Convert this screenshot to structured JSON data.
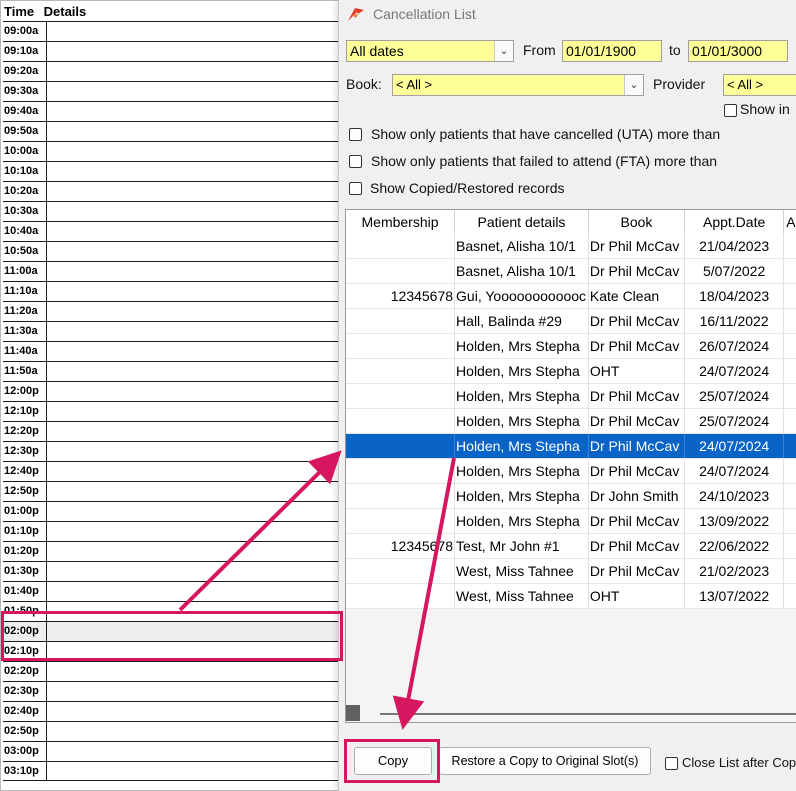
{
  "schedule": {
    "header": {
      "time": "Time",
      "details": "Details"
    },
    "times": [
      "09:00a",
      "09:10a",
      "09:20a",
      "09:30a",
      "09:40a",
      "09:50a",
      "10:00a",
      "10:10a",
      "10:20a",
      "10:30a",
      "10:40a",
      "10:50a",
      "11:00a",
      "11:10a",
      "11:20a",
      "11:30a",
      "11:40a",
      "11:50a",
      "12:00p",
      "12:10p",
      "12:20p",
      "12:30p",
      "12:40p",
      "12:50p",
      "01:00p",
      "01:10p",
      "01:20p",
      "01:30p",
      "01:40p",
      "01:50p",
      "02:00p",
      "02:10p",
      "02:20p",
      "02:30p",
      "02:40p",
      "02:50p",
      "03:00p",
      "03:10p"
    ]
  },
  "dialog": {
    "title": "Cancellation List",
    "date_filter": {
      "selected": "All dates",
      "from_label": "From",
      "from_value": "01/01/1900",
      "to_label": "to",
      "to_value": "01/01/3000"
    },
    "book": {
      "label": "Book:",
      "value": "< All >"
    },
    "provider": {
      "label": "Provider",
      "value": "< All >"
    },
    "show_in_label": "Show in",
    "options": [
      "Show only patients that have cancelled (UTA) more than",
      "Show only patients that failed to attend (FTA) more than",
      "Show Copied/Restored records"
    ],
    "table": {
      "headers": [
        "Membership",
        "Patient details",
        "Book",
        "Appt.Date",
        "A"
      ],
      "rows": [
        [
          "",
          "Basnet, Alisha 10/1",
          "Dr Phil McCav",
          "21/04/2023"
        ],
        [
          "",
          "Basnet, Alisha 10/1",
          "Dr Phil McCav",
          "5/07/2022"
        ],
        [
          "12345678",
          "Gui, Yoooooooooooc",
          "Kate Clean",
          "18/04/2023"
        ],
        [
          "",
          "Hall, Balinda #29",
          "Dr Phil McCav",
          "16/11/2022"
        ],
        [
          "",
          "Holden, Mrs Stepha",
          "Dr Phil McCav",
          "26/07/2024"
        ],
        [
          "",
          "Holden, Mrs Stepha",
          "OHT",
          "24/07/2024"
        ],
        [
          "",
          "Holden, Mrs Stepha",
          "Dr Phil McCav",
          "25/07/2024"
        ],
        [
          "",
          "Holden, Mrs Stepha",
          "Dr Phil McCav",
          "25/07/2024"
        ],
        [
          "",
          "Holden, Mrs Stepha",
          "Dr Phil McCav",
          "24/07/2024"
        ],
        [
          "",
          "Holden, Mrs Stepha",
          "Dr Phil McCav",
          "24/07/2024"
        ],
        [
          "",
          "Holden, Mrs Stepha",
          "Dr John Smith",
          "24/10/2023"
        ],
        [
          "",
          "Holden, Mrs Stepha",
          "Dr Phil McCav",
          "13/09/2022"
        ],
        [
          "12345678",
          "Test, Mr John #1",
          "Dr Phil McCav",
          "22/06/2022"
        ],
        [
          "",
          "West, Miss Tahnee",
          "Dr Phil McCav",
          "21/02/2023"
        ],
        [
          "",
          "West, Miss Tahnee",
          "OHT",
          "13/07/2022"
        ]
      ],
      "selected_row": 8
    },
    "buttons": {
      "copy": "Copy",
      "restore": "Restore a Copy to Original Slot(s)",
      "close_after": "Close List after Cop"
    }
  },
  "annotation_color": "#d6165f",
  "highlight_color": "#ffff99",
  "selection_color": "#0a64c8"
}
